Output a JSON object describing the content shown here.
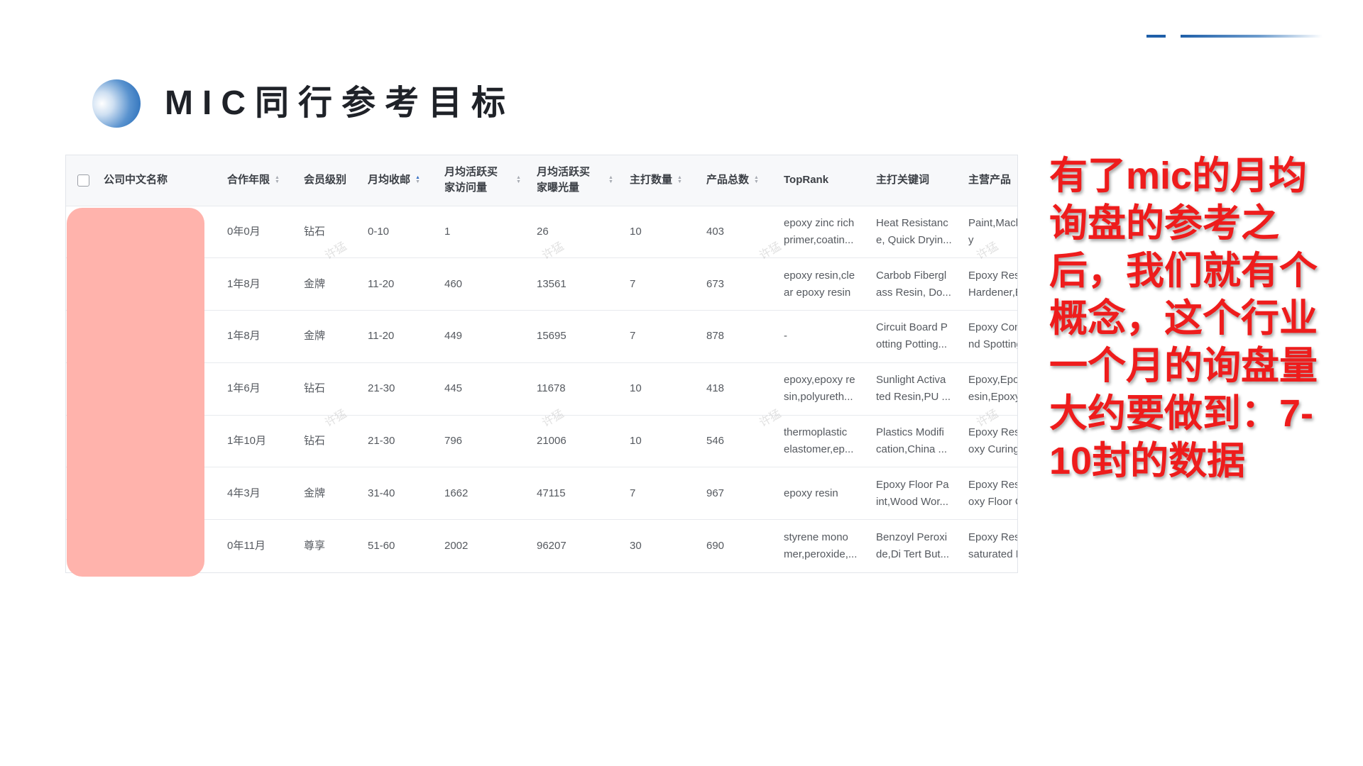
{
  "title": "MIC同行参考目标",
  "annotation": "有了mic的月均询盘的参考之后，我们就有个概念，这个行业一个月的询盘量大约要做到：7-10封的数据",
  "watermark": "许猛",
  "colors": {
    "accent": "#1f5fa8",
    "annotation": "#ee1c1c",
    "redaction": "#ffb3ac"
  },
  "table": {
    "headers": {
      "company": "公司中文名称",
      "years": "合作年限",
      "level": "会员级别",
      "inquiries": "月均收邮",
      "visitors": [
        "月均活跃买",
        "家访问量"
      ],
      "exposure": [
        "月均活跃买",
        "家曝光量"
      ],
      "main_count": "主打数量",
      "product_total": "产品总数",
      "toprank": "TopRank",
      "keywords": "主打关键词",
      "products": "主营产品"
    },
    "rows": [
      {
        "years": "0年0月",
        "level": "钻石",
        "inquiries": "0-10",
        "visitors": "1",
        "exposure": "26",
        "main_count": "10",
        "product_total": "403",
        "toprank": [
          "epoxy zinc rich",
          "primer,coatin..."
        ],
        "keywords": [
          "Heat Resistanc",
          "e, Quick Dryin..."
        ],
        "products": [
          "Paint,Mach",
          "y"
        ]
      },
      {
        "years": "1年8月",
        "level": "金牌",
        "inquiries": "11-20",
        "visitors": "460",
        "exposure": "13561",
        "main_count": "7",
        "product_total": "673",
        "toprank": [
          "epoxy resin,cle",
          "ar epoxy resin"
        ],
        "keywords": [
          "Carbob Fibergl",
          "ass Resin, Do..."
        ],
        "products": [
          "Epoxy Resin",
          "Hardener,Ep"
        ]
      },
      {
        "years": "1年8月",
        "level": "金牌",
        "inquiries": "11-20",
        "visitors": "449",
        "exposure": "15695",
        "main_count": "7",
        "product_total": "878",
        "toprank": [
          "-"
        ],
        "keywords": [
          "Circuit Board P",
          "otting Potting..."
        ],
        "products": [
          "Epoxy Com",
          "nd Spotting"
        ]
      },
      {
        "years": "1年6月",
        "level": "钻石",
        "inquiries": "21-30",
        "visitors": "445",
        "exposure": "11678",
        "main_count": "10",
        "product_total": "418",
        "toprank": [
          "epoxy,epoxy re",
          "sin,polyureth..."
        ],
        "keywords": [
          "Sunlight Activa",
          "ted Resin,PU ..."
        ],
        "products": [
          "Epoxy,Epox",
          "esin,Epoxy"
        ]
      },
      {
        "years": "1年10月",
        "level": "钻石",
        "inquiries": "21-30",
        "visitors": "796",
        "exposure": "21006",
        "main_count": "10",
        "product_total": "546",
        "toprank": [
          "thermoplastic",
          "elastomer,ep..."
        ],
        "keywords": [
          "Plastics Modifi",
          "cation,China ..."
        ],
        "products": [
          "Epoxy Resin",
          "oxy Curing"
        ]
      },
      {
        "years": "4年3月",
        "level": "金牌",
        "inquiries": "31-40",
        "visitors": "1662",
        "exposure": "47115",
        "main_count": "7",
        "product_total": "967",
        "toprank": [
          "epoxy resin"
        ],
        "keywords": [
          "Epoxy Floor Pa",
          "int,Wood Wor..."
        ],
        "products": [
          "Epoxy Resin",
          "oxy Floor C"
        ]
      },
      {
        "years": "0年11月",
        "level": "尊享",
        "inquiries": "51-60",
        "visitors": "2002",
        "exposure": "96207",
        "main_count": "30",
        "product_total": "690",
        "toprank": [
          "styrene mono",
          "mer,peroxide,..."
        ],
        "keywords": [
          "Benzoyl Peroxi",
          "de,Di Tert But..."
        ],
        "products": [
          "Epoxy Resin",
          "saturated P"
        ]
      }
    ]
  }
}
